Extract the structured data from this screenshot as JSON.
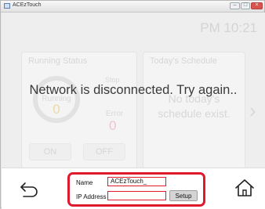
{
  "window": {
    "title": "ACEzTouch"
  },
  "status": {
    "clock": "PM 10:21",
    "message": "Network is disconnected. Try again.."
  },
  "running_status": {
    "title": "Running Status",
    "ring_label": "Running",
    "ring_value": "0",
    "stop_label": "Stop",
    "stop_value": "0",
    "error_label": "Error",
    "error_value": "0",
    "on_label": "ON",
    "off_label": "OFF"
  },
  "schedule": {
    "title": "Today's Schedule",
    "empty_line1": "No today's",
    "empty_line2": "schedule exist."
  },
  "form": {
    "name_label": "Name",
    "name_value": "ACEzTouch_",
    "ip_label": "IP Address",
    "ip_value": "",
    "setup_label": "Setup"
  },
  "colors": {
    "highlight": "#e0192f",
    "close_button": "#d9534f"
  },
  "icons": [
    "app-icon",
    "back-arrow-icon",
    "home-icon",
    "chevron-right-icon"
  ]
}
